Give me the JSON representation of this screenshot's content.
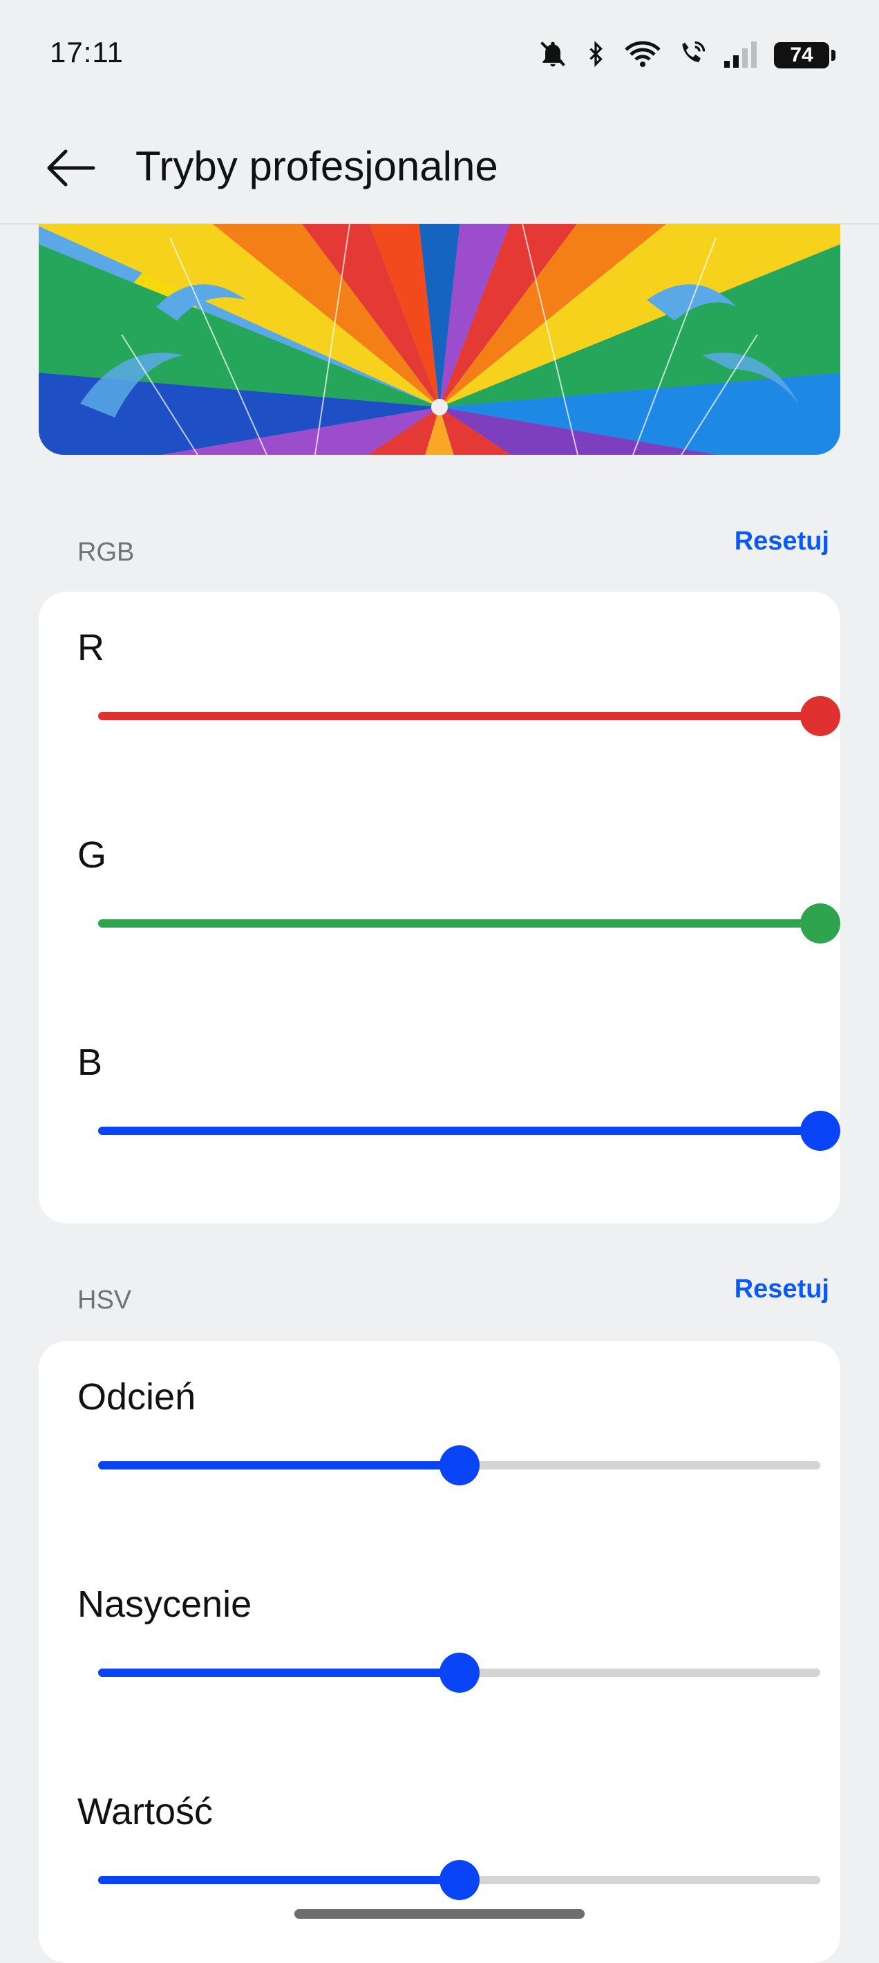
{
  "status_bar": {
    "time": "17:11",
    "battery": "74",
    "icons": [
      "bell-muted-icon",
      "bluetooth-icon",
      "wifi-icon",
      "wifi-calling-icon",
      "signal-icon",
      "battery-icon"
    ]
  },
  "app_bar": {
    "title": "Tryby profesjonalne",
    "back_icon": "arrow-left-icon"
  },
  "preview": {
    "description_icon": "parachute-preview-image"
  },
  "rgb": {
    "section_label": "RGB",
    "reset_label": "Resetuj",
    "sliders": [
      {
        "label": "R",
        "value": 1.0,
        "color": "#e03131"
      },
      {
        "label": "G",
        "value": 1.0,
        "color": "#2ea44f"
      },
      {
        "label": "B",
        "value": 1.0,
        "color": "#0a44f7"
      }
    ]
  },
  "hsv": {
    "section_label": "HSV",
    "reset_label": "Resetuj",
    "sliders": [
      {
        "label": "Odcień",
        "value": 0.5,
        "color": "#0a44f7"
      },
      {
        "label": "Nasycenie",
        "value": 0.5,
        "color": "#0a44f7"
      },
      {
        "label": "Wartość",
        "value": 0.5,
        "color": "#0a44f7"
      }
    ]
  },
  "colors": {
    "accent": "#0a59f7",
    "track_inactive": "#d4d4d4",
    "background": "#eff0f2"
  }
}
